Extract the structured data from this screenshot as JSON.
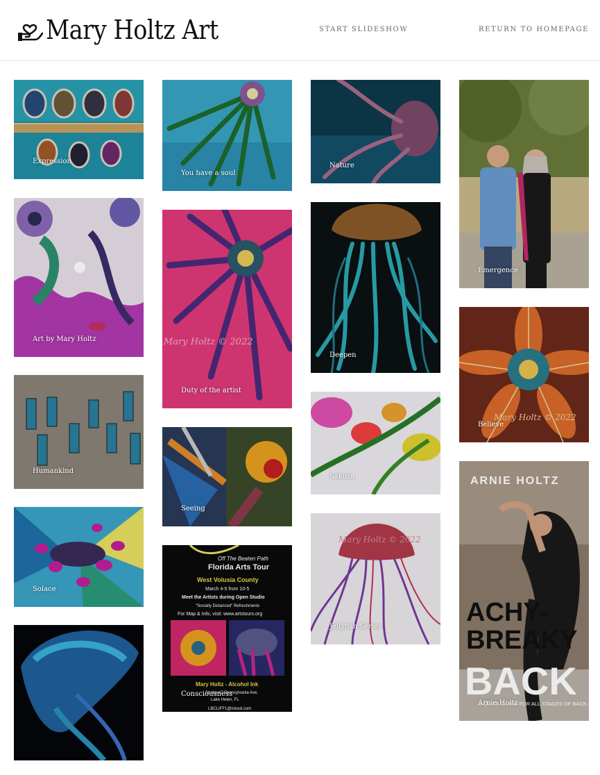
{
  "site": {
    "title": "Mary Holtz Art",
    "nav": {
      "slideshow": "START SLIDESHOW",
      "home": "RETURN TO HOMEPAGE"
    }
  },
  "gallery": [
    {
      "caption": "Expression"
    },
    {
      "caption": "Art by Mary Holtz"
    },
    {
      "caption": "Humankind"
    },
    {
      "caption": "Solace"
    },
    {
      "caption": ""
    },
    {
      "caption": "You have a soul"
    },
    {
      "caption": "Duty of the artist"
    },
    {
      "caption": "Seeing"
    },
    {
      "caption": "Consciousness"
    },
    {
      "caption": "Nature"
    },
    {
      "caption": "Deepen"
    },
    {
      "caption": "Sakura"
    },
    {
      "caption": "Jellyfish Series"
    },
    {
      "caption": "Emergence"
    },
    {
      "caption": "Believe"
    },
    {
      "caption": "Arnie Holtz"
    }
  ],
  "artwork_text": {
    "signature_1": "Mary Holtz © 2022",
    "signature_2": "Mary Holtz © 2022",
    "signature_3": "Mary Holtz © 2022",
    "poster_line_1": "Off The Beaten Path",
    "poster_line_2": "Florida Arts Tour",
    "poster_line_3": "West Volusia County",
    "poster_line_4": "March 4-5 from 10-5",
    "poster_line_5": "Meet the Artists during Open Studio",
    "poster_line_6": "\"Socially Distanced\" Refreshments",
    "poster_line_7": "For Map & Info, visit: www.artstours.org",
    "poster_line_8": "Mary Holtz - Alcohol Ink",
    "poster_line_9": "Studio #7  Pennsylvania Ave.",
    "poster_line_10": "Lake Helen, FL",
    "poster_line_11": "LBCLIFF1@icloud.com",
    "book_author": "ARNIE HOLTZ",
    "book_title_1": "ACHY-",
    "book_title_2": "BREAKY",
    "book_title_3": "BACK",
    "book_subtitle": "A QUICK GUIDE FOR ALL STAGES OF BACK PAIN"
  },
  "colors": {
    "header_border": "#e6e6e6",
    "nav_text": "#666666",
    "caption_text": "#ffffff"
  },
  "icons": {
    "logo": "hand-holding-heart-icon"
  }
}
